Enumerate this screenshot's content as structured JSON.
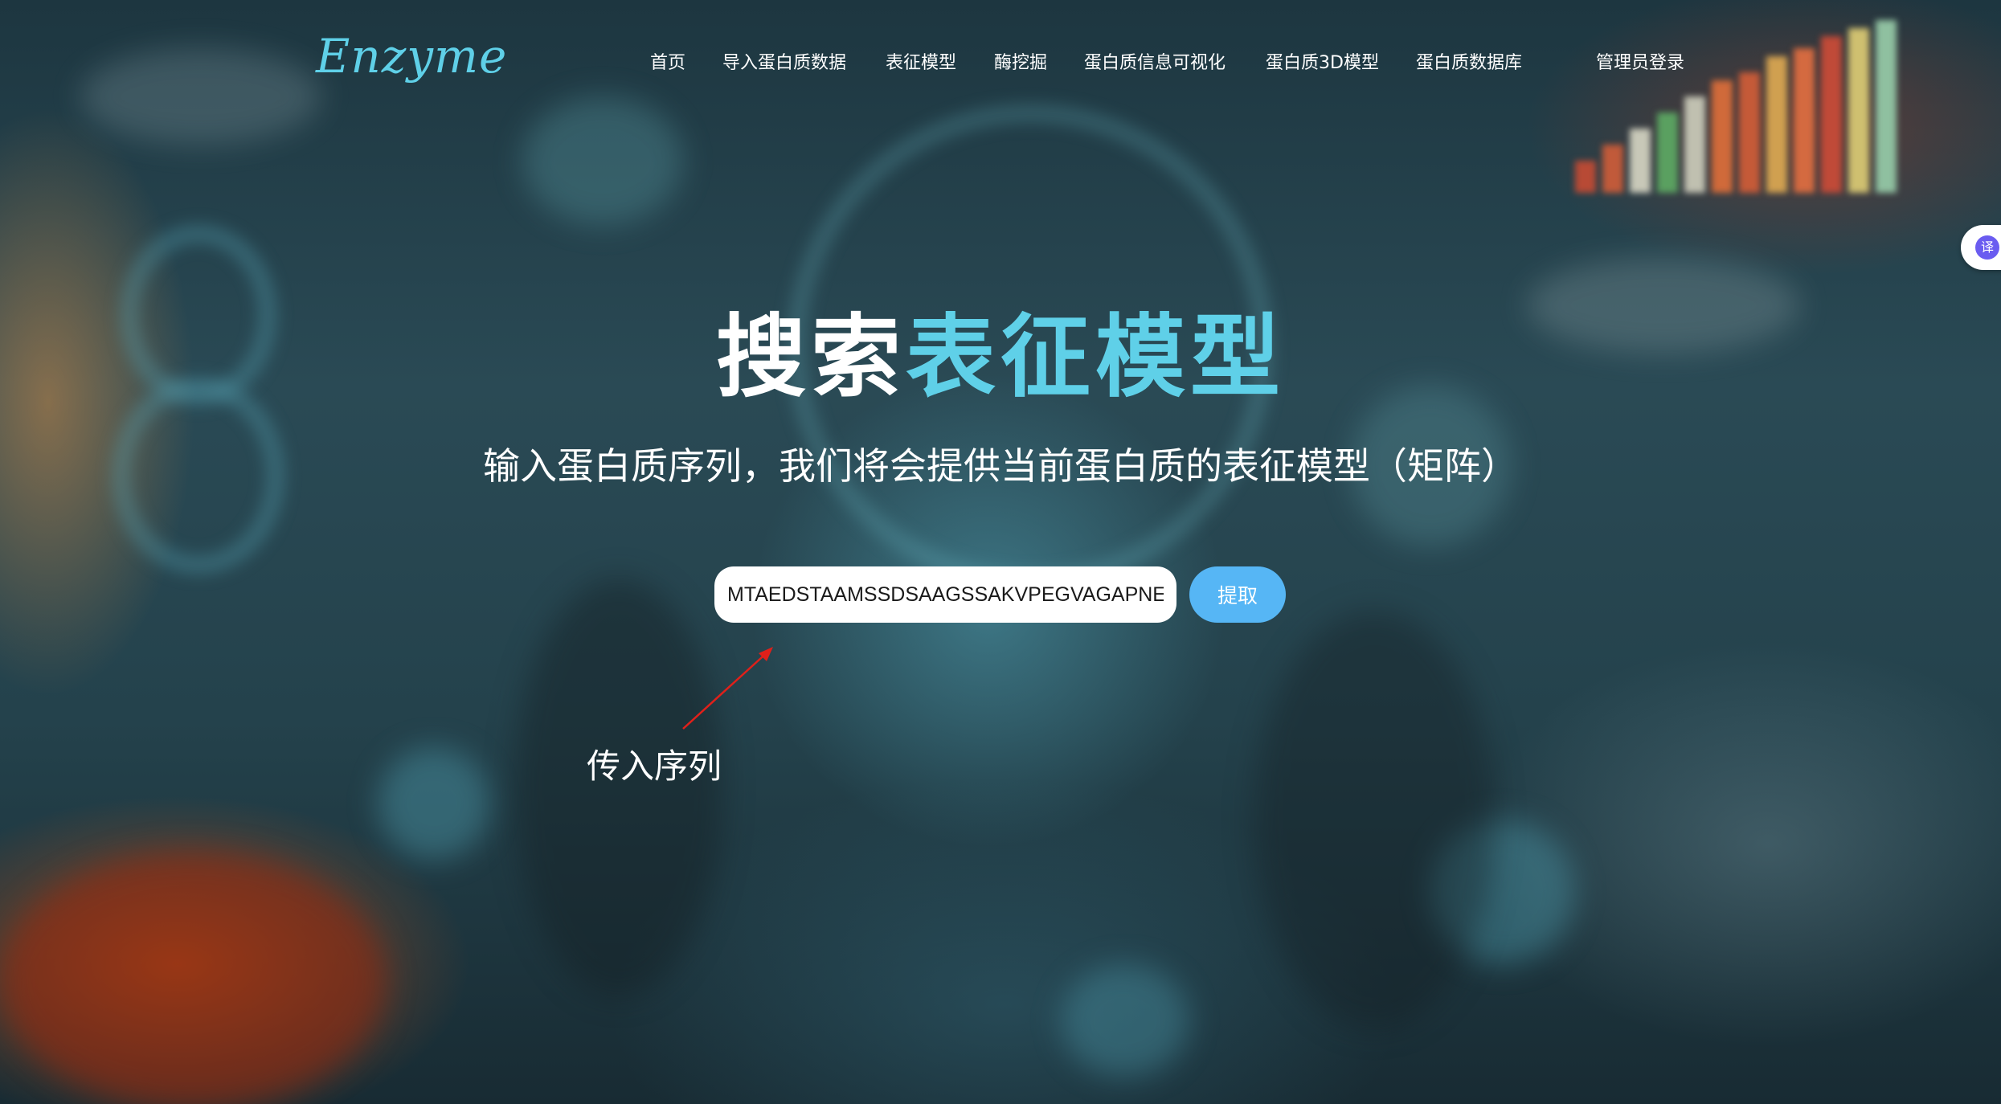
{
  "header": {
    "logo": "Enzyme",
    "nav": [
      {
        "label": "首页"
      },
      {
        "label": "导入蛋白质数据"
      },
      {
        "label": "表征模型"
      },
      {
        "label": "酶挖掘"
      },
      {
        "label": "蛋白质信息可视化"
      },
      {
        "label": "蛋白质3D模型"
      },
      {
        "label": "蛋白质数据库"
      },
      {
        "label": "管理员登录"
      }
    ]
  },
  "hero": {
    "title_part1": "搜索",
    "title_part2": "表征模型",
    "subtitle": "输入蛋白质序列，我们将会提供当前蛋白质的表征模型（矩阵）",
    "title_color_accent": "#5fd0e8"
  },
  "search": {
    "value": "MTAEDSTAAMSSDSAAGSSAKVPEGVAGAPNEAALL",
    "button_label": "提取"
  },
  "annotation": {
    "label": "传入序列",
    "color": "#e0201a"
  },
  "translate_tab": {
    "icon": "translate-icon",
    "glyph": "译"
  }
}
